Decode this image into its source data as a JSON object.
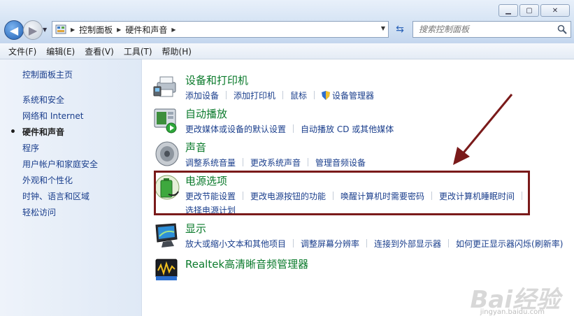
{
  "address": {
    "crumbs": [
      "控制面板",
      "硬件和声音"
    ]
  },
  "search": {
    "placeholder": "搜索控制面板"
  },
  "menu": [
    "文件(F)",
    "编辑(E)",
    "查看(V)",
    "工具(T)",
    "帮助(H)"
  ],
  "sidebar": {
    "home": "控制面板主页",
    "items": [
      {
        "label": "系统和安全"
      },
      {
        "label": "网络和 Internet"
      },
      {
        "label": "硬件和声音",
        "active": true
      },
      {
        "label": "程序"
      },
      {
        "label": "用户帐户和家庭安全"
      },
      {
        "label": "外观和个性化"
      },
      {
        "label": "时钟、语言和区域"
      },
      {
        "label": "轻松访问"
      }
    ]
  },
  "categories": {
    "devices": {
      "title": "设备和打印机",
      "icon": "printer-icon",
      "links": [
        "添加设备",
        "添加打印机",
        "鼠标",
        "设备管理器"
      ]
    },
    "autoplay": {
      "title": "自动播放",
      "icon": "autoplay-icon",
      "links": [
        "更改媒体或设备的默认设置",
        "自动播放 CD 或其他媒体"
      ]
    },
    "sound": {
      "title": "声音",
      "icon": "speaker-icon",
      "links": [
        "调整系统音量",
        "更改系统声音",
        "管理音频设备"
      ]
    },
    "power": {
      "title": "电源选项",
      "icon": "battery-icon",
      "links": [
        "更改节能设置",
        "更改电源按钮的功能",
        "唤醒计算机时需要密码",
        "更改计算机睡眠时间",
        "选择电源计划"
      ]
    },
    "display": {
      "title": "显示",
      "icon": "monitor-icon",
      "links": [
        "放大或缩小文本和其他项目",
        "调整屏幕分辨率",
        "连接到外部显示器",
        "如何更正显示器闪烁(刷新率)"
      ]
    },
    "realtek": {
      "title": "Realtek高清晰音频管理器",
      "icon": "realtek-icon"
    }
  },
  "annotation": {
    "color": "#7a1a1a"
  },
  "watermark": {
    "text": "Bai经验",
    "sub": "jingyan.baidu.com"
  }
}
